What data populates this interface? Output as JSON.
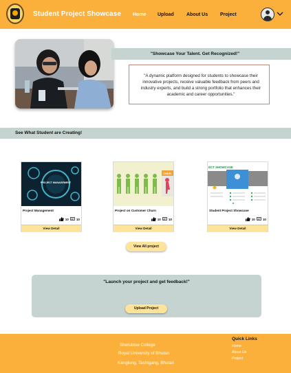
{
  "header": {
    "brand": "Student Project Showcase",
    "nav": [
      "Home",
      "Upload",
      "About Us",
      "Project"
    ],
    "icons": {
      "logo": "college-crest-icon",
      "avatar": "user-avatar-icon",
      "menu": "chevron-down-icon"
    }
  },
  "hero": {
    "tagline": "\"Showcase Your Talent. Get Recognized!\"",
    "description": "\"A dynamic platform designed for students to showcase their innovative projects, receive valuable feedback from peers and industry experts, and build a strong portfolio that enhances their academic and career opportunities.\""
  },
  "section": {
    "title": "See What Student are Creating!"
  },
  "projects": [
    {
      "title": "Project Management",
      "likes": "10",
      "comments": "10",
      "button": "View Detail",
      "image_text": "PROJECT MANAGEMENT"
    },
    {
      "title": "Project on Customer Churn",
      "likes": "10",
      "comments": "10",
      "button": "View Detail",
      "image_text": "CHUR"
    },
    {
      "title": "Student Project Showcase",
      "likes": "10",
      "comments": "10",
      "button": "View Detail",
      "image_text": "ECT SHOWCASE"
    }
  ],
  "view_all": "View All project",
  "cta": {
    "text": "\"Launch your project and get feedback!\"",
    "button": "Upload Project"
  },
  "footer": {
    "college": "Sherubtse College",
    "university": "Royal University of Bhutan",
    "address": "Kanglung, Tashigang, Bhutan",
    "quick_links_title": "Quick Links",
    "quick_links": [
      "Home",
      "About Us",
      "Project"
    ]
  },
  "colors": {
    "primary": "#fbb03b",
    "band": "#c5d4d1",
    "button": "#fde49a"
  }
}
